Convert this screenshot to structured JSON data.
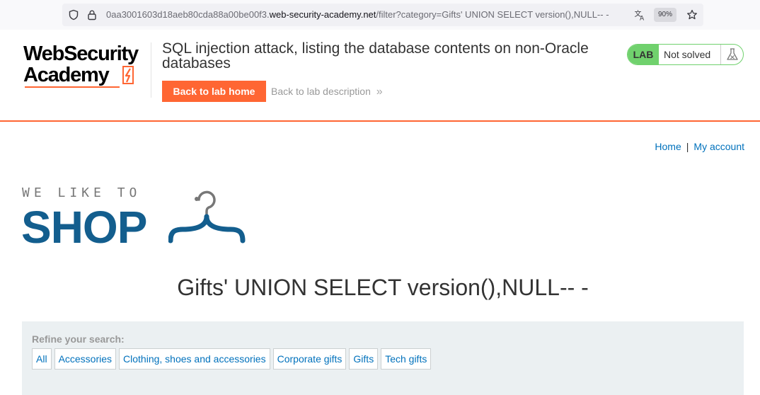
{
  "browser": {
    "url_prefix": "0aa3001603d18aeb80cda88a00be00f3.",
    "url_domain": "web-security-academy.net",
    "url_path": "/filter?category=Gifts' UNION SELECT version(),NULL-- -",
    "zoom": "90%",
    "icons": [
      "shield-icon",
      "lock-icon",
      "translate-icon",
      "star-icon"
    ]
  },
  "lab_header": {
    "logo_line1": "WebSecurity",
    "logo_line2": "Academy",
    "title": "SQL injection attack, listing the database contents on non-Oracle databases",
    "back_home": "Back to lab home",
    "back_description": "Back to lab description",
    "chevron": "»",
    "badge": "LAB",
    "status": "Not solved",
    "accent_color": "#ff6633",
    "status_color": "#70d16d"
  },
  "nav": {
    "home": "Home",
    "separator": "|",
    "account": "My account"
  },
  "shop_logo": {
    "tagline": "WE LIKE TO",
    "word": "SHOP",
    "brand_color": "#135e8e"
  },
  "heading": "Gifts' UNION SELECT version(),NULL-- -",
  "filter": {
    "label": "Refine your search:",
    "categories": [
      "All",
      "Accessories",
      "Clothing, shoes and accessories",
      "Corporate gifts",
      "Gifts",
      "Tech gifts"
    ]
  }
}
